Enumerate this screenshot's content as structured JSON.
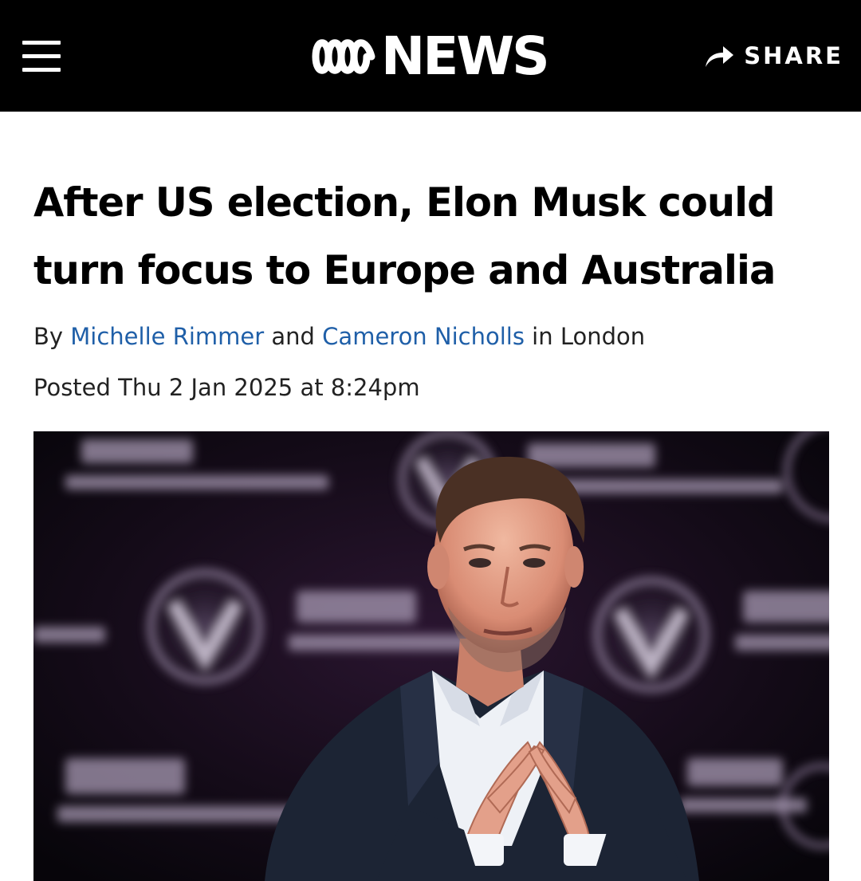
{
  "header": {
    "logo_text": "NEWS",
    "share_label": "SHARE"
  },
  "article": {
    "headline": "After US election, Elon Musk could turn focus to Europe and Australia",
    "byline": {
      "prefix": "By",
      "author1": "Michelle Rimmer",
      "conjunction": "and",
      "author2": "Cameron Nicholls",
      "suffix": "in London"
    },
    "posted": "Posted Thu 2 Jan 2025 at 8:24pm"
  },
  "colors": {
    "header_bg": "#000000",
    "link": "#1f5fa8",
    "text": "#000000"
  },
  "icons": {
    "menu": "hamburger-menu-icon",
    "share": "share-arrow-icon",
    "logo": "abc-lissajous-logo"
  }
}
